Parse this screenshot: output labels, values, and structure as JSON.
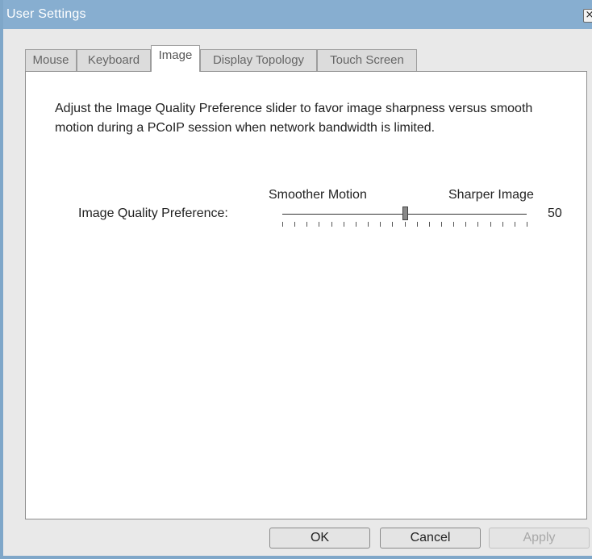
{
  "window": {
    "title": "User Settings",
    "close_glyph": "×"
  },
  "tabs": [
    {
      "label": "Mouse",
      "active": false
    },
    {
      "label": "Keyboard",
      "active": false
    },
    {
      "label": "Image",
      "active": true
    },
    {
      "label": "Display Topology",
      "active": false
    },
    {
      "label": "Touch Screen",
      "active": false
    }
  ],
  "image_tab": {
    "description": "Adjust the Image Quality Preference slider to favor image sharpness versus smooth motion during a PCoIP session when network bandwidth is limited.",
    "slider": {
      "label": "Image Quality Preference:",
      "left_label": "Smoother Motion",
      "right_label": "Sharper Image",
      "min": 0,
      "max": 100,
      "value": 50,
      "value_text": "50",
      "tick_count": 21
    }
  },
  "buttons": {
    "ok": "OK",
    "cancel": "Cancel",
    "apply": "Apply"
  },
  "colors": {
    "titlebar": "#87aed0",
    "frame": "#7fa7c9",
    "window_bg": "#e9e9e9"
  }
}
